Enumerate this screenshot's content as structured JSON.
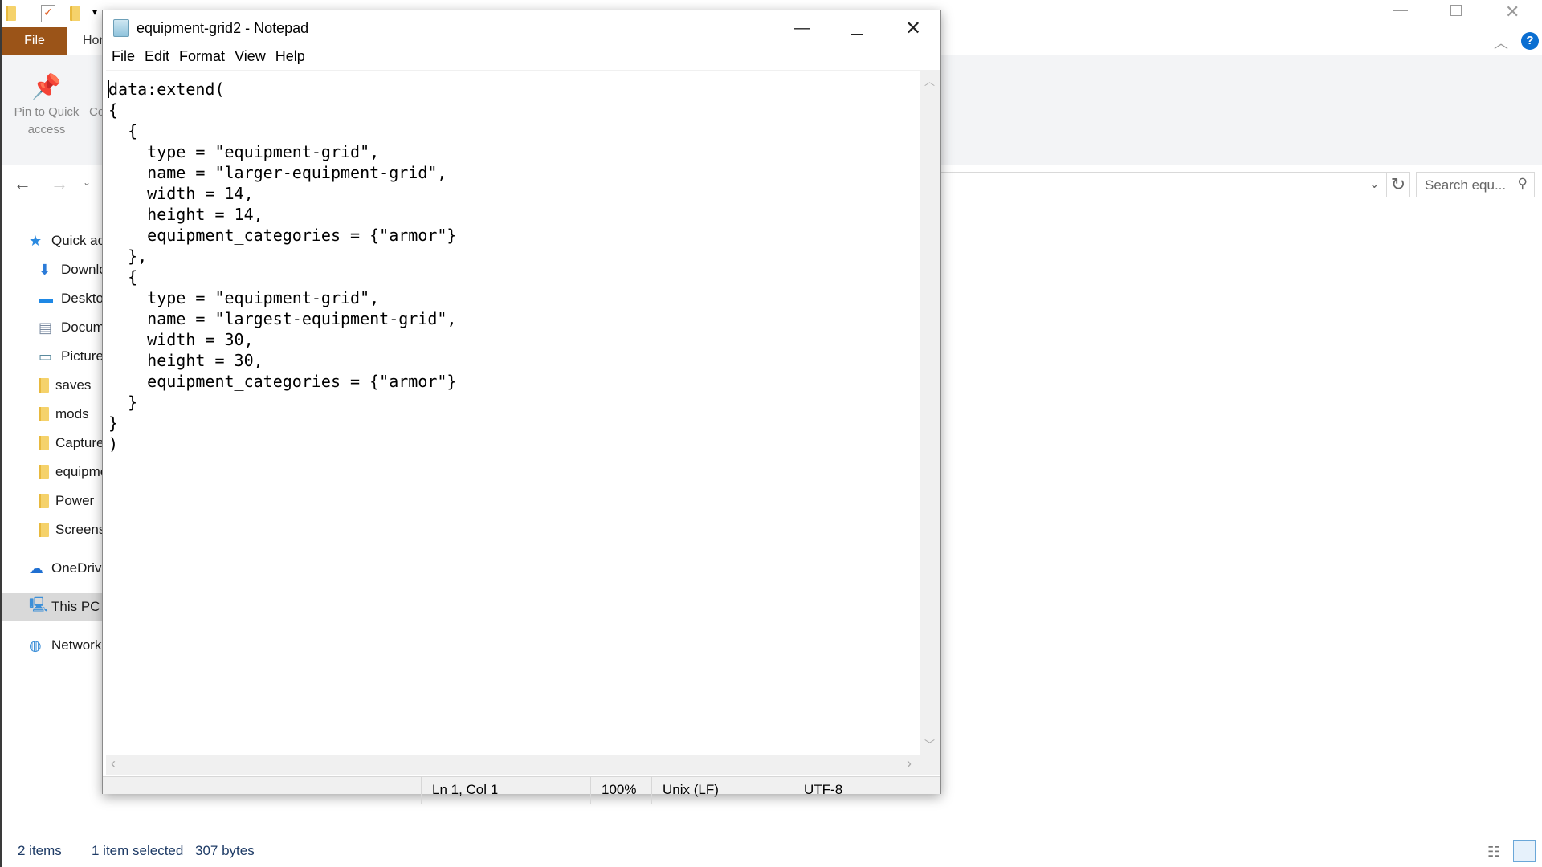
{
  "explorer": {
    "ribbon_tabs": {
      "file": "File",
      "home": "Home"
    },
    "ribbon": {
      "pin_label": "Pin to Quick access",
      "copy_label": "Co"
    },
    "search_placeholder": "Search equ...",
    "nav": {
      "items": [
        {
          "label": "Quick access",
          "icon": "star-icon"
        },
        {
          "label": "Downloads",
          "icon": "download-icon"
        },
        {
          "label": "Desktop",
          "icon": "desktop-icon"
        },
        {
          "label": "Documents",
          "icon": "document-icon"
        },
        {
          "label": "Pictures",
          "icon": "pictures-icon"
        },
        {
          "label": "saves",
          "icon": "folder-icon"
        },
        {
          "label": "mods",
          "icon": "folder-icon"
        },
        {
          "label": "Captures",
          "icon": "folder-icon"
        },
        {
          "label": "equipment",
          "icon": "folder-icon"
        },
        {
          "label": "Power",
          "icon": "folder-icon"
        },
        {
          "label": "Screenshots",
          "icon": "folder-icon"
        },
        {
          "label": "OneDrive",
          "icon": "cloud-icon"
        },
        {
          "label": "This PC",
          "icon": "computer-icon"
        },
        {
          "label": "Network",
          "icon": "network-icon"
        }
      ]
    },
    "status": {
      "items": "2 items",
      "selected": "1 item selected",
      "size": "307 bytes"
    }
  },
  "notepad": {
    "title": "equipment-grid2 - Notepad",
    "menu": [
      "File",
      "Edit",
      "Format",
      "View",
      "Help"
    ],
    "content": "data:extend(\n{\n  {\n    type = \"equipment-grid\",\n    name = \"larger-equipment-grid\",\n    width = 14,\n    height = 14,\n    equipment_categories = {\"armor\"}\n  },\n  {\n    type = \"equipment-grid\",\n    name = \"largest-equipment-grid\",\n    width = 30,\n    height = 30,\n    equipment_categories = {\"armor\"}\n  }\n}\n)",
    "status": {
      "position": "Ln 1, Col 1",
      "zoom": "100%",
      "line_endings": "Unix (LF)",
      "encoding": "UTF-8"
    }
  },
  "colors": {
    "file_tab": "#9b5418",
    "help": "#0a6ed1"
  }
}
